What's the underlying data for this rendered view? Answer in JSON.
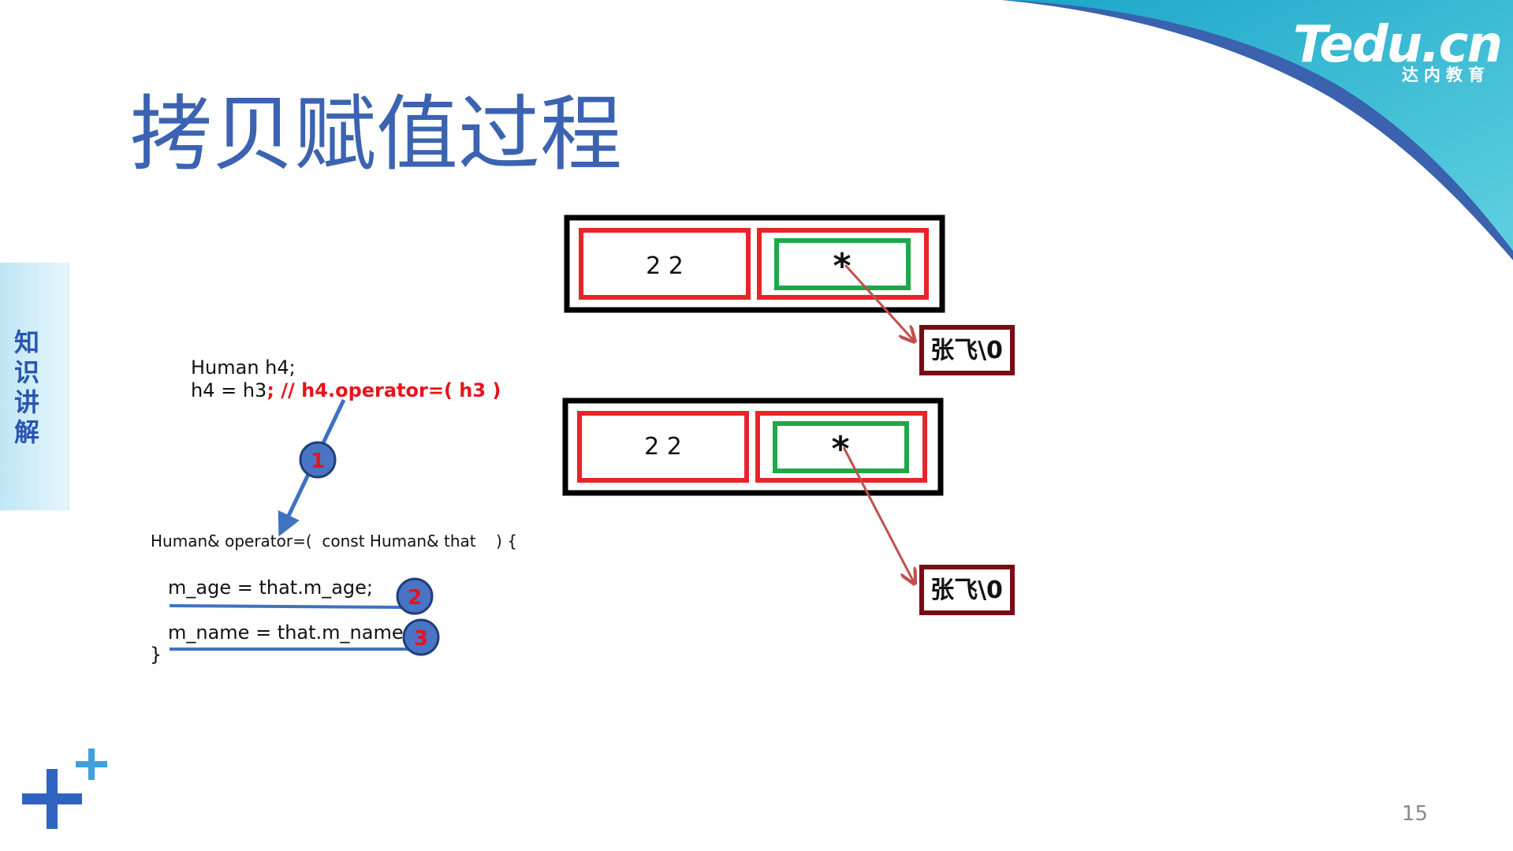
{
  "slide": {
    "title": "拷贝赋值过程",
    "side_tab": [
      "知",
      "识",
      "讲",
      "解"
    ],
    "page_number": "15",
    "brand": {
      "logo": "Tedu.cn",
      "tagline": "达内教育",
      "accent": "#3cc1d6"
    }
  },
  "code": {
    "line1": "Human h4;",
    "line2_code": "h4 = h3",
    "line2_semi": ";",
    "line2_comment": " // h4.operator=( h3 )",
    "signature": "Human& operator=(  const Human& that    ) {",
    "stmt_age": "m_age = that.m_age;",
    "stmt_name": "m_name = that.m_name;",
    "close_brace": "}"
  },
  "objects": [
    {
      "age": "2 2",
      "pointer": "*",
      "target": "张飞\\0"
    },
    {
      "age": "2 2",
      "pointer": "*",
      "target": "张飞\\0"
    }
  ],
  "steps": [
    "1",
    "2",
    "3"
  ],
  "colors": {
    "title": "#3b63b1",
    "comment": "#e8131b",
    "member_border": "#e8242b",
    "pointer_border": "#1fa84a",
    "string_border": "#7a0a14",
    "arrow": "#c0504d",
    "step_fill": "#4a74c4"
  }
}
